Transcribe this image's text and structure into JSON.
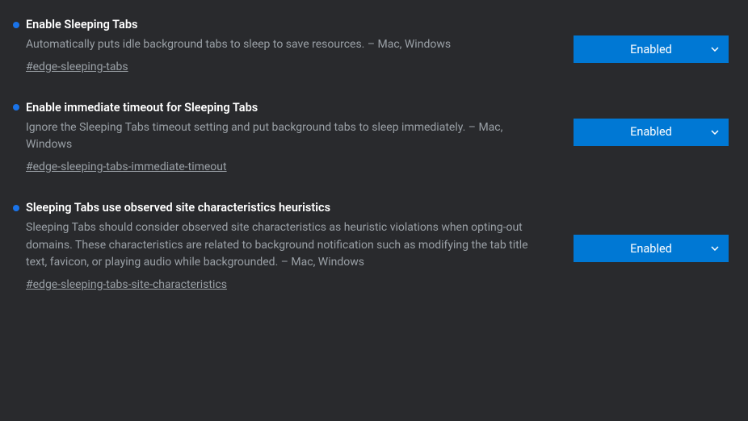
{
  "flags": [
    {
      "title": "Enable Sleeping Tabs",
      "description": "Automatically puts idle background tabs to sleep to save resources. – Mac, Windows",
      "anchor": "#edge-sleeping-tabs",
      "state": "Enabled"
    },
    {
      "title": "Enable immediate timeout for Sleeping Tabs",
      "description": "Ignore the Sleeping Tabs timeout setting and put background tabs to sleep immediately. – Mac, Windows",
      "anchor": "#edge-sleeping-tabs-immediate-timeout",
      "state": "Enabled"
    },
    {
      "title": "Sleeping Tabs use observed site characteristics heuristics",
      "description": "Sleeping Tabs should consider observed site characteristics as heuristic violations when opting-out domains. These characteristics are related to background notification such as modifying the tab title text, favicon, or playing audio while backgrounded. – Mac, Windows",
      "anchor": "#edge-sleeping-tabs-site-characteristics",
      "state": "Enabled"
    }
  ],
  "colors": {
    "accent": "#0078d4",
    "dot": "#1a73e8",
    "bg": "#292a2d"
  }
}
